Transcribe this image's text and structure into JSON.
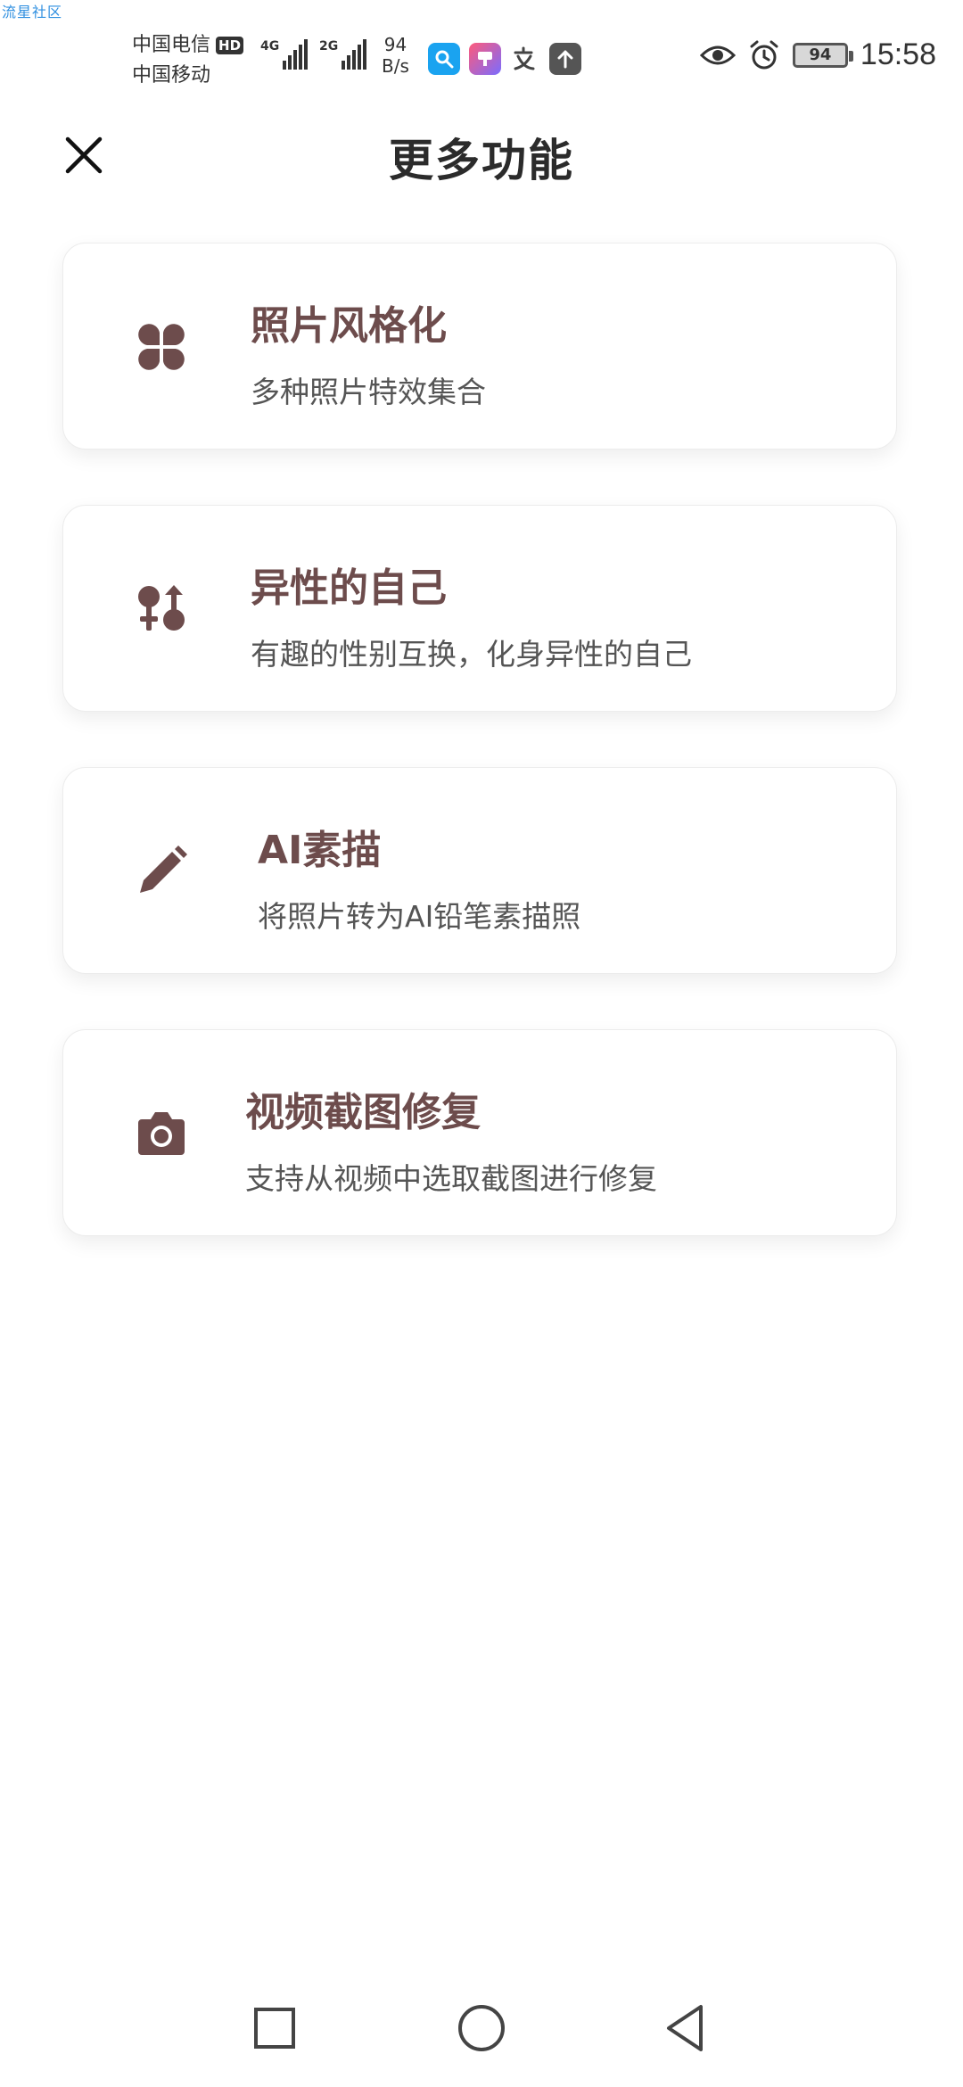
{
  "watermark": "流星社区",
  "status_bar": {
    "carrier_1": "中国电信",
    "hd_badge": "HD",
    "carrier_2": "中国移动",
    "signal_1_tag": "4G",
    "signal_2_tag": "2G",
    "net_speed_value": "94",
    "net_speed_unit": "B/s",
    "battery": "94",
    "time": "15:58"
  },
  "header": {
    "title": "更多功能",
    "close_icon": "close-icon"
  },
  "cards": [
    {
      "title": "照片风格化",
      "subtitle": "多种照片特效集合",
      "icon": "clover-icon"
    },
    {
      "title": "异性的自己",
      "subtitle": "有趣的性别互换，化身异性的自己",
      "icon": "gender-swap-icon"
    },
    {
      "title": "AI素描",
      "subtitle": "将照片转为AI铅笔素描照",
      "icon": "pencil-icon"
    },
    {
      "title": "视频截图修复",
      "subtitle": "支持从视频中选取截图进行修复",
      "icon": "camera-icon"
    }
  ],
  "colors": {
    "accent": "#6d4c4c",
    "title_text": "#2b2b2b",
    "subtitle_text": "#555555"
  }
}
